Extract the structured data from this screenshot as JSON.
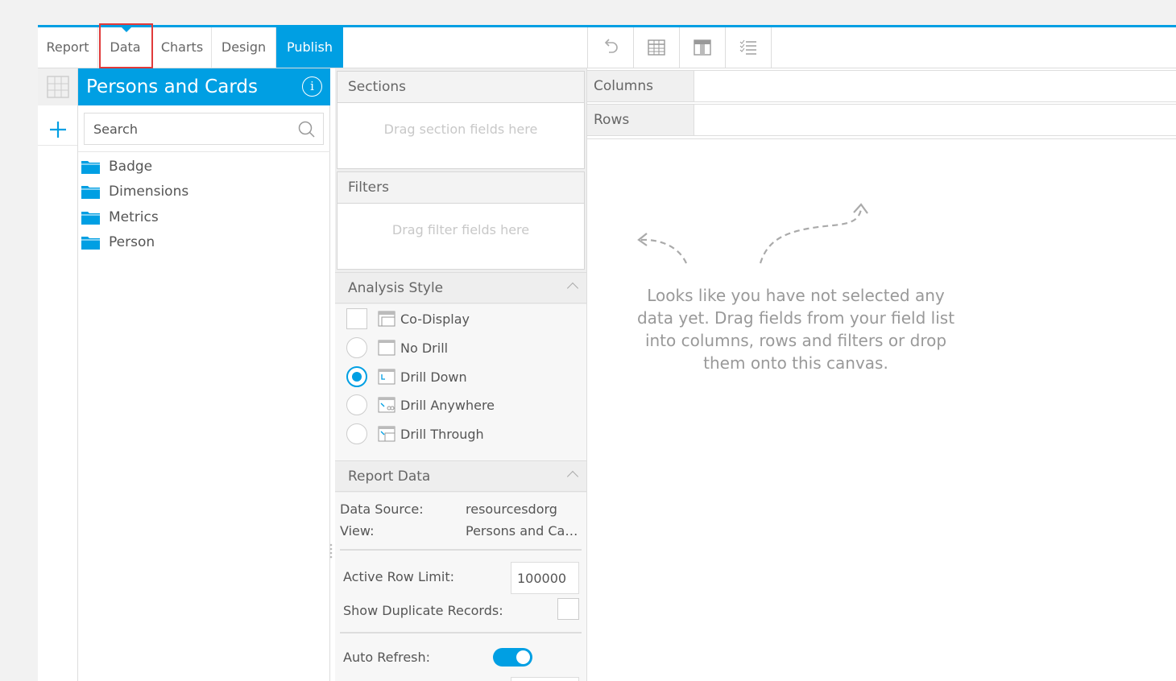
{
  "tabs": {
    "report": "Report",
    "data": "Data",
    "charts": "Charts",
    "design": "Design",
    "publish": "Publish"
  },
  "field_panel": {
    "title": "Persons and Cards",
    "search_placeholder": "Search",
    "folders": [
      "Badge",
      "Dimensions",
      "Metrics",
      "Person"
    ]
  },
  "sections": {
    "title": "Sections",
    "drop_hint": "Drag section fields here"
  },
  "filters": {
    "title": "Filters",
    "drop_hint": "Drag filter fields here"
  },
  "analysis_style": {
    "title": "Analysis Style",
    "options": [
      "Co-Display",
      "No Drill",
      "Drill Down",
      "Drill Anywhere",
      "Drill Through"
    ],
    "selected": "Drill Down"
  },
  "report_data": {
    "title": "Report Data",
    "data_source_label": "Data Source:",
    "data_source_value": "resourcesdorg",
    "view_label": "View:",
    "view_value": "Persons and Cards",
    "row_limit_label": "Active Row Limit:",
    "row_limit_value": "100000",
    "duplicates_label": "Show Duplicate Records:",
    "auto_refresh_label": "Auto Refresh:"
  },
  "shelves": {
    "columns": "Columns",
    "rows": "Rows"
  },
  "canvas": {
    "hint": "Looks like you have not selected any data yet. Drag fields from your field list into columns, rows and filters or drop them onto this canvas."
  },
  "colors": {
    "accent": "#009fe3",
    "highlight": "#e03b3b"
  }
}
